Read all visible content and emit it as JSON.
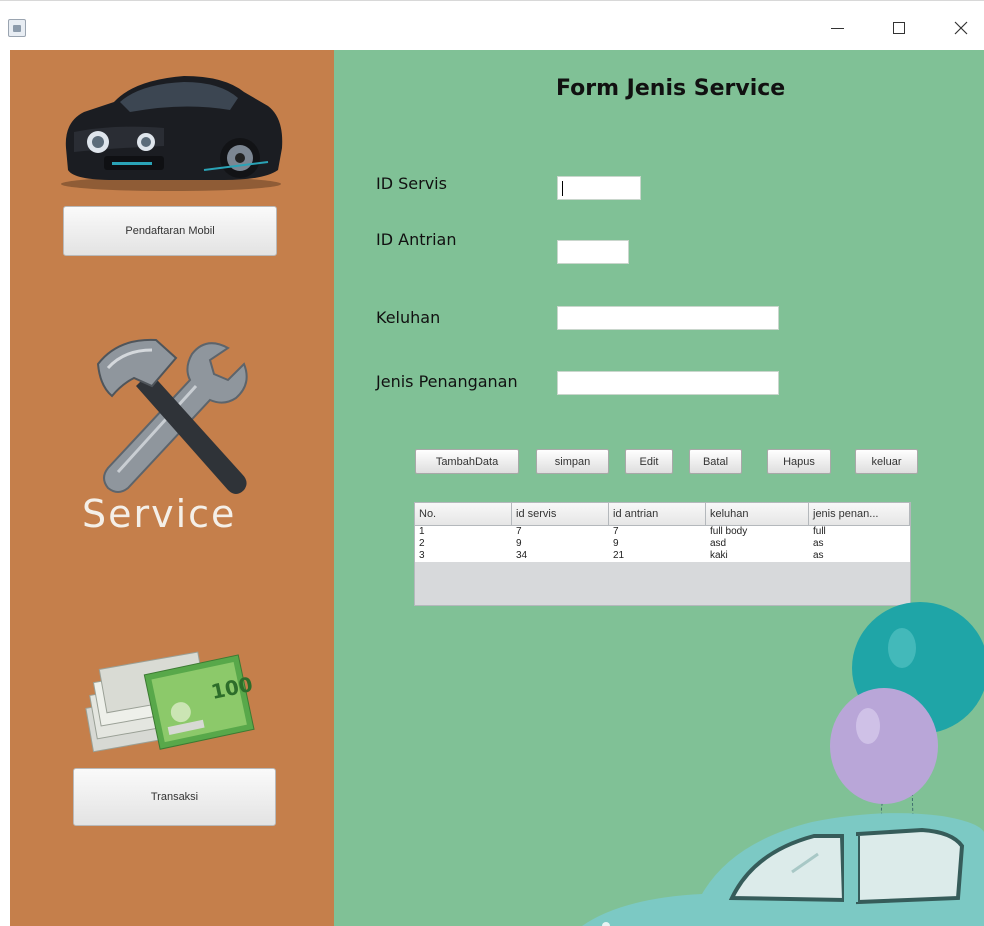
{
  "window": {
    "minimize_icon": "minimize-icon",
    "maximize_icon": "maximize-icon",
    "close_icon": "close-icon"
  },
  "sidebar": {
    "pendaftaran_label": "Pendaftaran Mobil",
    "service_text": "Service",
    "transaksi_label": "Transaksi",
    "images": [
      "car-image",
      "tools-image",
      "money-image"
    ]
  },
  "form": {
    "title": "Form Jenis Service",
    "labels": {
      "id_servis": "ID Servis",
      "id_antrian": "ID Antrian",
      "keluhan": "Keluhan",
      "jenis_penanganan": "Jenis Penanganan"
    },
    "values": {
      "id_servis": "",
      "id_antrian": "",
      "keluhan": "",
      "jenis_penanganan": ""
    },
    "buttons": {
      "tambah": "TambahData",
      "simpan": "simpan",
      "edit": "Edit",
      "batal": "Batal",
      "hapus": "Hapus",
      "keluar": "keluar"
    }
  },
  "table": {
    "columns": [
      "No.",
      "id servis",
      "id antrian",
      "keluhan",
      "jenis penan..."
    ],
    "rows": [
      [
        "1",
        "7",
        "7",
        "full body",
        "full"
      ],
      [
        "2",
        "9",
        "9",
        "asd",
        "as"
      ],
      [
        "3",
        "34",
        "21",
        "kaki",
        "as"
      ]
    ]
  },
  "colors": {
    "sidebar_bg": "#c57f4b",
    "main_bg": "#80c196"
  }
}
